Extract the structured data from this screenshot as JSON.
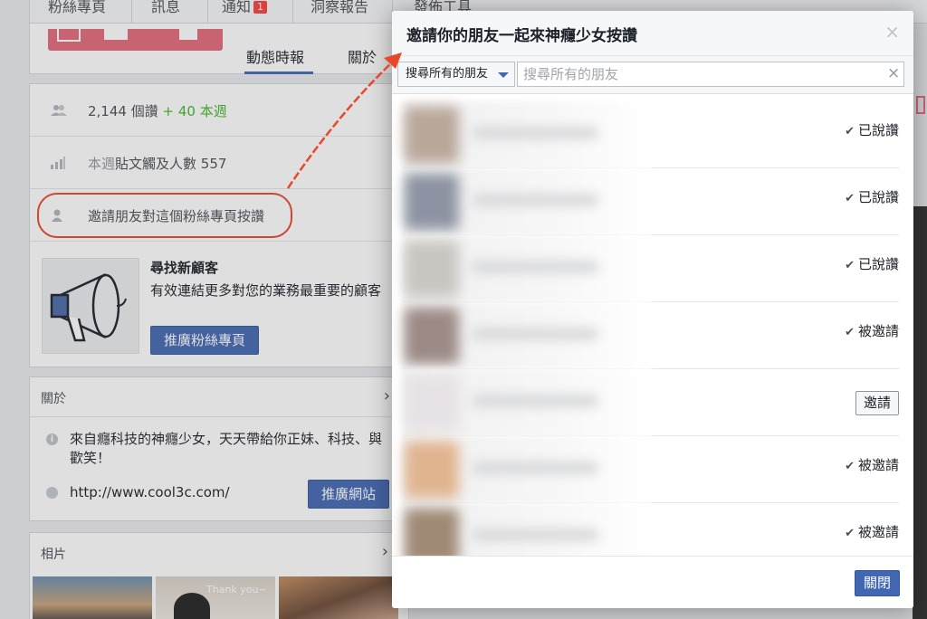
{
  "topnav": {
    "items": [
      "粉絲專頁",
      "訊息",
      "通知",
      "洞察報告",
      "發佈工具"
    ],
    "notif_count": "1"
  },
  "page": {
    "tabs": [
      "動態時報",
      "關於"
    ],
    "stats": {
      "likes": "2,144 個讚",
      "likes_week": "+ 40 本週",
      "reach_prefix": "本週",
      "reach": "貼文觸及人數 557",
      "invite": "邀請朋友對這個粉絲專頁按讚"
    },
    "promo": {
      "title": "尋找新顧客",
      "desc": "有效連結更多對您的業務最重要的顧客",
      "button": "推廣粉絲專頁"
    },
    "about": {
      "header": "關於",
      "desc": "來自癮科技的神癮少女，天天帶給你正妹、科技、與歡笑！",
      "url": "http://www.cool3c.com/",
      "button": "推廣網站"
    },
    "photos": {
      "header": "相片",
      "caption": "Thank you~"
    }
  },
  "modal": {
    "title": "邀請你的朋友一起來神癮少女按讚",
    "close_glyph": "×",
    "filter_select": "搜尋所有的朋友",
    "search_placeholder": "搜尋所有的朋友",
    "search_clear_glyph": "×",
    "friends": [
      {
        "status": "已說讚",
        "state": "liked"
      },
      {
        "status": "已說讚",
        "state": "liked"
      },
      {
        "status": "已說讚",
        "state": "liked"
      },
      {
        "status": "被邀請",
        "state": "invited"
      },
      {
        "status": "邀請",
        "state": "invite"
      },
      {
        "status": "被邀請",
        "state": "invited"
      },
      {
        "status": "被邀請",
        "state": "invited"
      }
    ],
    "close_button": "關閉"
  },
  "colors": {
    "accent": "#4267b2",
    "annotation": "#e8472b",
    "green": "#42b72a"
  }
}
